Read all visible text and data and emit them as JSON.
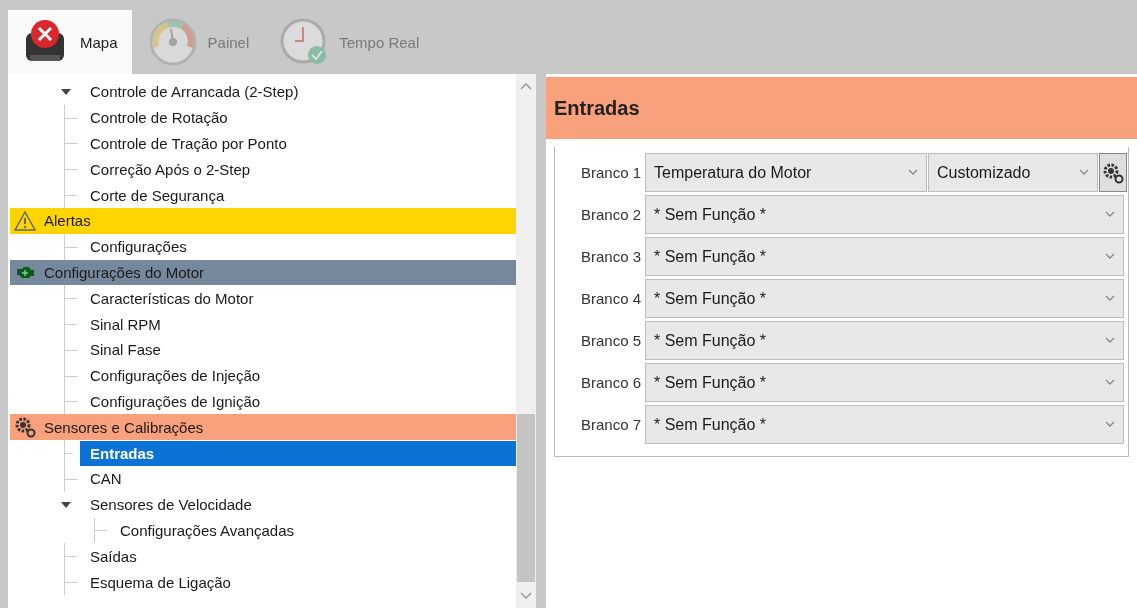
{
  "tabs": [
    {
      "label": "Mapa",
      "kind": "map",
      "selected": true,
      "disabled": false
    },
    {
      "label": "Painel",
      "kind": "gauge",
      "selected": false,
      "disabled": true
    },
    {
      "label": "Tempo Real",
      "kind": "clock",
      "selected": false,
      "disabled": true
    }
  ],
  "tree": [
    {
      "items": [
        {
          "label": "Controle de Arrancada (2-Step)",
          "selected": false,
          "expanded": true
        },
        {
          "label": "Controle de Rotação",
          "selected": false
        },
        {
          "label": "Controle de Tração por Ponto",
          "selected": false
        },
        {
          "label": "Correção Após o 2-Step",
          "selected": false
        },
        {
          "label": "Corte de Segurança",
          "selected": false
        }
      ]
    },
    {
      "title": "Alertas",
      "kind": "alert",
      "color": "#ffd500",
      "items": [
        {
          "label": "Configurações",
          "selected": false
        }
      ]
    },
    {
      "title": "Configurações do Motor",
      "kind": "engine",
      "color": "#76899c",
      "items": [
        {
          "label": "Características do Motor",
          "selected": false
        },
        {
          "label": "Sinal RPM",
          "selected": false
        },
        {
          "label": "Sinal Fase",
          "selected": false
        },
        {
          "label": "Configurações de Injeção",
          "selected": false
        },
        {
          "label": "Configurações de Ignição",
          "selected": false
        }
      ]
    },
    {
      "title": "Sensores e Calibrações",
      "kind": "gears",
      "color": "#f9a07c",
      "items": [
        {
          "label": "Entradas",
          "selected": true
        },
        {
          "label": "CAN",
          "selected": false
        },
        {
          "label": "Sensores de Velocidade",
          "selected": false,
          "expanded": true,
          "children": [
            {
              "label": "Configurações Avançadas",
              "selected": false
            }
          ]
        },
        {
          "label": "Saídas",
          "selected": false
        },
        {
          "label": "Esquema de Ligação",
          "selected": false
        }
      ]
    }
  ],
  "panel": {
    "title": "Entradas",
    "inputs": [
      {
        "label": "Branco 1",
        "function": "Temperatura do Motor",
        "mode": "Customizado"
      },
      {
        "label": "Branco 2",
        "function": "* Sem Função *"
      },
      {
        "label": "Branco 3",
        "function": "* Sem Função *"
      },
      {
        "label": "Branco 4",
        "function": "* Sem Função *"
      },
      {
        "label": "Branco 5",
        "function": "* Sem Função *"
      },
      {
        "label": "Branco 6",
        "function": "* Sem Função *"
      },
      {
        "label": "Branco 7",
        "function": "* Sem Função *"
      }
    ]
  }
}
